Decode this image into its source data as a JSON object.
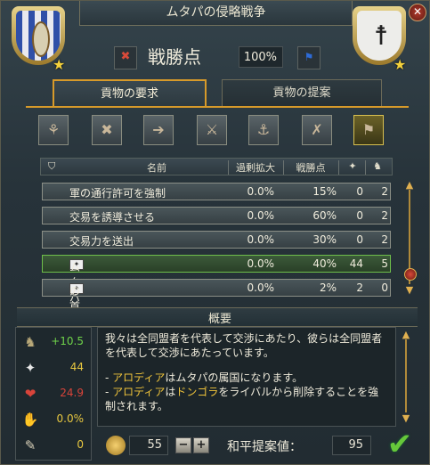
{
  "window": {
    "title": "ムタパの侵略戦争",
    "close_glyph": "✕"
  },
  "war_score": {
    "label": "戦勝点",
    "value": "100%"
  },
  "tabs": [
    {
      "label": "貢物の要求",
      "active": true
    },
    {
      "label": "貢物の提案",
      "active": false
    }
  ],
  "options": [
    {
      "icon": "alliance-icon",
      "glyph": "⚘"
    },
    {
      "icon": "scroll-cross-icon",
      "glyph": "✖"
    },
    {
      "icon": "scroll-transfer-icon",
      "glyph": "➔"
    },
    {
      "icon": "weapons-cross-icon",
      "glyph": "⚔"
    },
    {
      "icon": "ships-icon",
      "glyph": "⚓"
    },
    {
      "icon": "ship-cancel-icon",
      "glyph": "✗"
    },
    {
      "icon": "pillars-icon",
      "glyph": "⚑"
    }
  ],
  "table": {
    "headers": {
      "name": "名前",
      "overextension": "過剰拡大",
      "warscore": "戦勝点"
    },
    "rows": [
      {
        "name": "軍の通行許可を強制",
        "ov": "0.0%",
        "ws": "15%",
        "a": "0",
        "b": "2",
        "selected": false
      },
      {
        "name": "交易を誘導させる",
        "ov": "0.0%",
        "ws": "60%",
        "a": "0",
        "b": "2",
        "selected": false
      },
      {
        "name": "交易力を送出",
        "ov": "0.0%",
        "ws": "30%",
        "a": "0",
        "b": "2",
        "selected": false
      },
      {
        "name": "ムタパ属国",
        "ov": "0.0%",
        "ws": "40%",
        "a": "44",
        "b": "5",
        "selected": true
      },
      {
        "name_mid": "が",
        "name_tail": "の首都を略奪",
        "ov": "0.0%",
        "ws": "2%",
        "a": "2",
        "b": "0",
        "selected": false
      }
    ]
  },
  "summary": {
    "title": "概要",
    "stats": [
      {
        "icon": "prestige-icon",
        "glyph": "♞",
        "value": "+10.5",
        "color": "#6fd34a"
      },
      {
        "icon": "dove-icon",
        "glyph": "✦",
        "value": "44",
        "color": "#e8c840"
      },
      {
        "icon": "broken-heart-icon",
        "glyph": "❤",
        "value": "24.9",
        "color": "#d8443a"
      },
      {
        "icon": "handshake-icon",
        "glyph": "✋",
        "value": "0.0%",
        "color": "#e8c840"
      },
      {
        "icon": "scroll-icon",
        "glyph": "✎",
        "value": "0",
        "color": "#e8c840"
      }
    ],
    "text": {
      "p1": "我々は全同盟者を代表して交渉にあたり、彼らは全同盟者を代表して交渉にあたっています。",
      "b1_prefix": "- ",
      "b1_country": "アロディア",
      "b1_rest": "はムタパの属国になります。",
      "b2_prefix": "- ",
      "b2_country": "アロディア",
      "b2_mid": "は",
      "b2_rival": "ドンゴラ",
      "b2_rest": "をライバルから削除することを強制されます。"
    }
  },
  "bottom": {
    "money": "55",
    "minus": "−",
    "plus": "+",
    "peace_label": "和平提案値：",
    "peace_value": "95",
    "confirm_glyph": "✔"
  }
}
